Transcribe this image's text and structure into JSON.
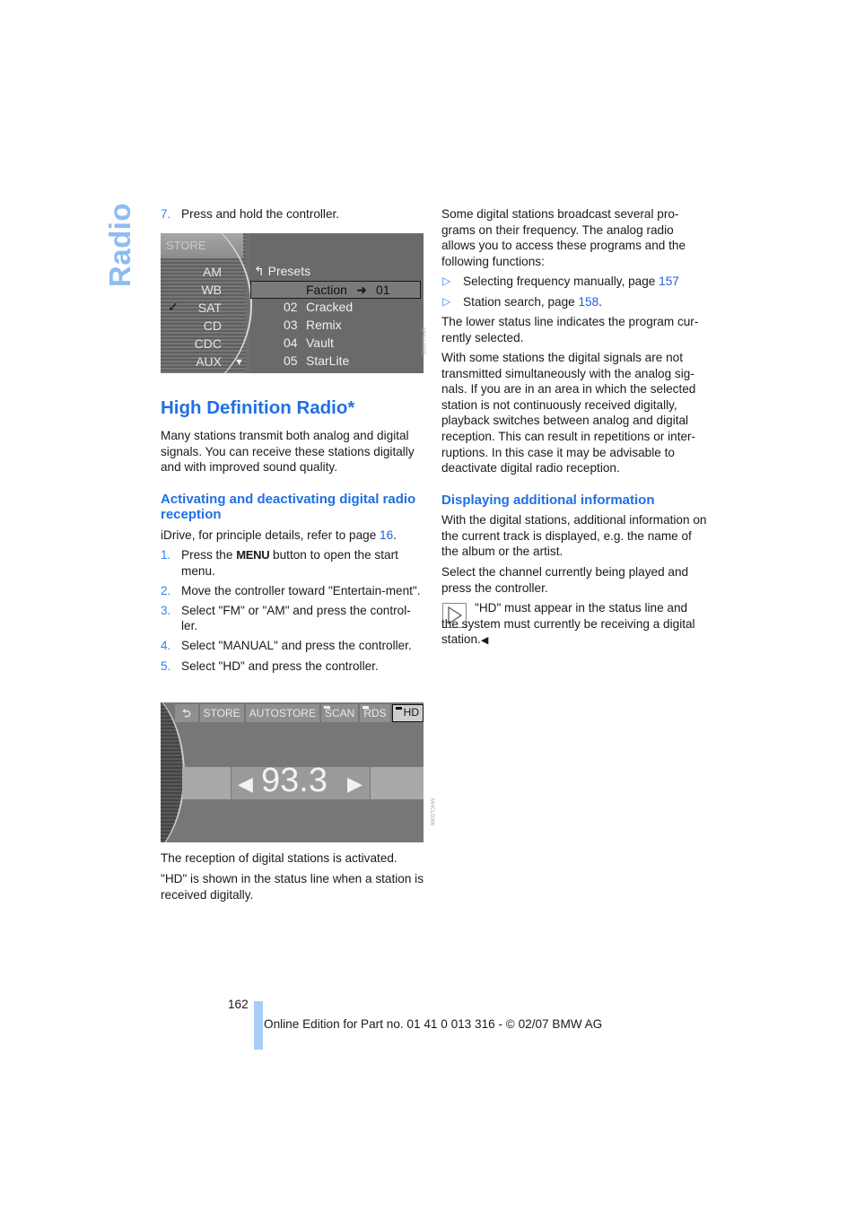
{
  "side_title": "Radio",
  "left": {
    "step7": {
      "num": "7.",
      "text": "Press and hold the controller."
    },
    "screen1": {
      "store_label": "STORE",
      "sources": [
        "AM",
        "WB",
        "SAT",
        "CD",
        "CDC",
        "AUX"
      ],
      "selected_source_check": "✓",
      "presets_icon": "↰",
      "presets_label": "Presets",
      "selected_row": {
        "name": "Faction",
        "arrow": "➜",
        "num": "01"
      },
      "rows": [
        {
          "num": "02",
          "name": "Cracked"
        },
        {
          "num": "03",
          "name": "Remix"
        },
        {
          "num": "04",
          "name": "Vault"
        },
        {
          "num": "05",
          "name": "StarLite"
        }
      ],
      "image_code": "MHCL0065"
    },
    "heading": "High Definition Radio*",
    "intro": "Many stations transmit both analog and digital signals. You can receive these stations digitally and with improved sound quality.",
    "subheading": "Activating and deactivating digital radio reception",
    "idrive_prefix": "iDrive, for principle details, refer to page ",
    "idrive_page": "16",
    "idrive_suffix": ".",
    "steps": [
      {
        "num": "1.",
        "pre": "Press the ",
        "key": "MENU",
        "post": " button to open the start menu."
      },
      {
        "num": "2.",
        "text": "Move the controller toward \"Entertain-ment\"."
      },
      {
        "num": "3.",
        "text": "Select \"FM\" or \"AM\" and press the control-ler."
      },
      {
        "num": "4.",
        "text": "Select \"MANUAL\" and press the controller."
      },
      {
        "num": "5.",
        "text": "Select \"HD\" and press the controller."
      }
    ],
    "screen2": {
      "tabs": [
        "⮌",
        "STORE",
        "AUTOSTORE",
        "SCAN",
        "RDS",
        "HD"
      ],
      "active_tab": "HD",
      "frequency": "93.3",
      "left_arrow": "◀",
      "right_arrow": "▶",
      "image_code": "MHCL0066"
    },
    "after1": "The reception of digital stations is activated.",
    "after2": "\"HD\" is shown in the status line when a station is received digitally."
  },
  "right": {
    "para1": "Some digital stations broadcast several pro-grams on their frequency. The analog radio allows you to access these programs and the following functions:",
    "bullets": [
      {
        "text": "Selecting frequency manually, page ",
        "page": "157",
        "suffix": ""
      },
      {
        "text": "Station search, page ",
        "page": "158",
        "suffix": "."
      }
    ],
    "para2": "The lower status line indicates the program cur-rently selected.",
    "para3": "With some stations the digital signals are not transmitted simultaneously with the analog sig-nals. If you are in an area in which the selected station is not continuously received digitally, playback switches between analog and digital reception. This can result in repetitions or inter-ruptions. In this case it may be advisable to deactivate digital radio reception.",
    "subheading": "Displaying additional information",
    "para4": "With the digital stations, additional information on the current track is displayed, e.g. the name of the album or the artist.",
    "para5": "Select the channel currently being played and press the controller.",
    "note": "\"HD\" must appear in the status line and the system must currently be receiving a digital station.",
    "note_end": "◀"
  },
  "footer": {
    "page_number": "162",
    "edition": "Online Edition for Part no. 01 41 0 013 316 - © 02/07 BMW AG"
  }
}
